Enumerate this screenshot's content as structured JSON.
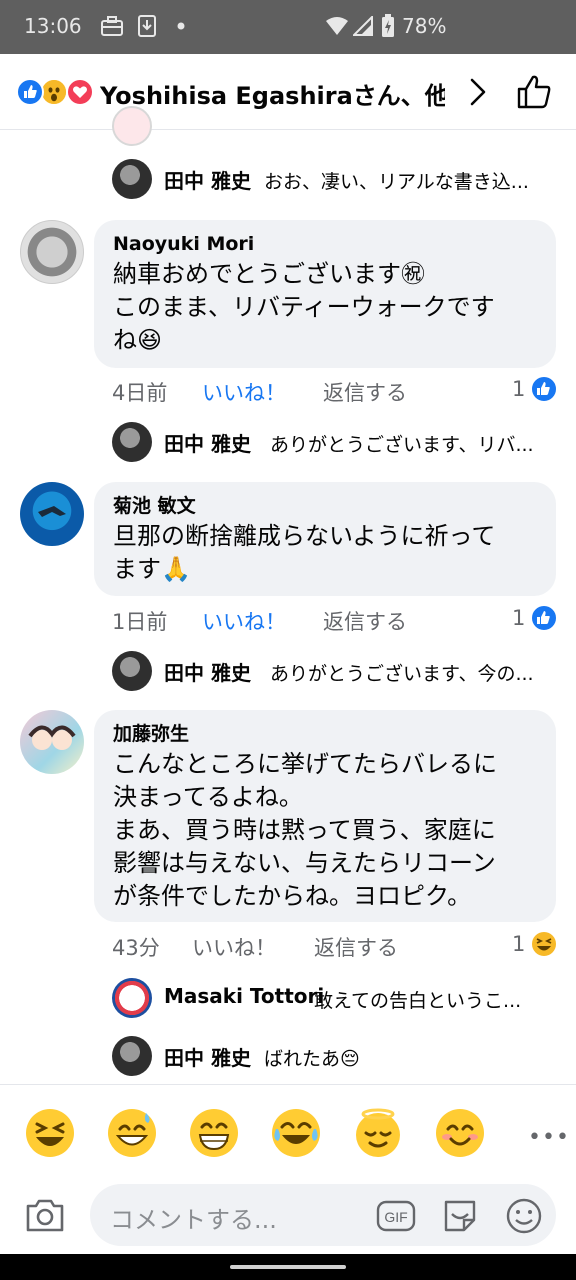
{
  "status_bar": {
    "time": "13:06",
    "battery": "78%",
    "icons": [
      "briefcase-icon",
      "download-icon",
      "dot-icon",
      "wifi-icon",
      "signal-icon",
      "battery-icon"
    ]
  },
  "header": {
    "title": "Yoshihisa Egashiraさん、他...",
    "reaction_icons": [
      "like-reaction-icon",
      "wow-reaction-icon",
      "love-reaction-icon"
    ],
    "colors": {
      "like": "#1877f2",
      "love": "#f33e58",
      "wow": "#f7b928"
    }
  },
  "thread": {
    "top_reply": {
      "name": "田中 雅史",
      "text": "おお、凄い、リアルな書き込..."
    },
    "comments": [
      {
        "name": "Naoyuki Mori",
        "lines": [
          "納車おめでとうございます㊗",
          "このまま、リバティーウォークです",
          "ね😆"
        ],
        "time": "4日前",
        "like_label": "いいね！",
        "reply_label": "返信する",
        "reaction_count": "1",
        "reaction_icon": "like-reaction-icon",
        "replies": [
          {
            "name": "田中 雅史",
            "text": "ありがとうございます、リバ..."
          }
        ]
      },
      {
        "name": "菊池 敏文",
        "lines": [
          "旦那の断捨離成らないように祈って",
          "ます🙏"
        ],
        "time": "1日前",
        "like_label": "いいね！",
        "reply_label": "返信する",
        "reaction_count": "1",
        "reaction_icon": "like-reaction-icon",
        "replies": [
          {
            "name": "田中 雅史",
            "text": "ありがとうございます、今の..."
          }
        ]
      },
      {
        "name": "加藤弥生",
        "lines": [
          "こんなところに挙げてたらバレるに",
          "決まってるよね。",
          "まあ、買う時は黙って買う、家庭に",
          "影響は与えない、与えたらリコーン",
          "が条件でしたからね。ヨロピク。"
        ],
        "time": "43分",
        "like_label": "いいね！",
        "reply_label": "返信する",
        "reaction_count": "1",
        "reaction_icon": "haha-reaction-icon",
        "replies": [
          {
            "name": "Masaki Tottori",
            "text": "敢えての告白というこ..."
          },
          {
            "name": "田中 雅史",
            "text": "ばれたあ😔"
          }
        ]
      }
    ]
  },
  "emoji_bar": {
    "emojis": [
      "😆",
      "😅",
      "😁",
      "😂",
      "😌",
      "😊"
    ],
    "more": "•••"
  },
  "composer": {
    "placeholder": "コメントする...",
    "gif_label": "GIF"
  }
}
